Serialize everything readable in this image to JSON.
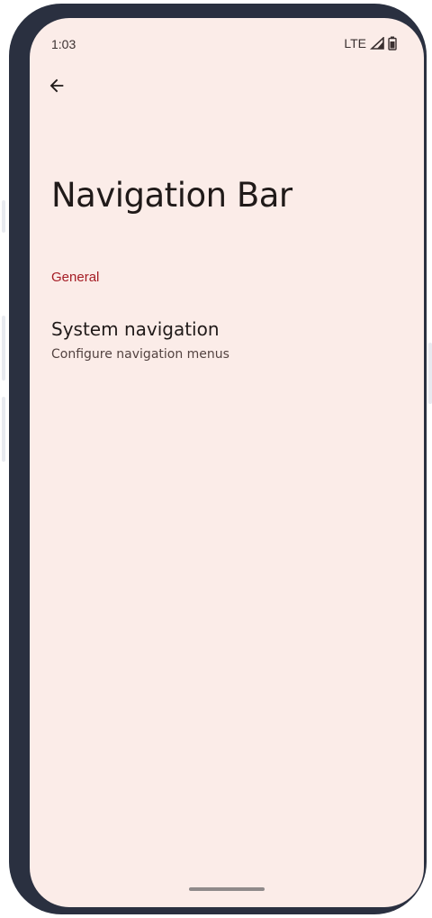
{
  "status_bar": {
    "time": "1:03",
    "network": "LTE",
    "icons": [
      "signal-icon",
      "battery-icon"
    ]
  },
  "toolbar": {
    "back_icon": "back-arrow-icon"
  },
  "page": {
    "title": "Navigation Bar"
  },
  "sections": [
    {
      "header": "General",
      "items": [
        {
          "title": "System navigation",
          "summary": "Configure navigation menus"
        }
      ]
    }
  ],
  "colors": {
    "background": "#fbece8",
    "frame": "#2a3040",
    "accent": "#a51c24",
    "text_primary": "#201a19",
    "text_secondary": "#534341"
  }
}
